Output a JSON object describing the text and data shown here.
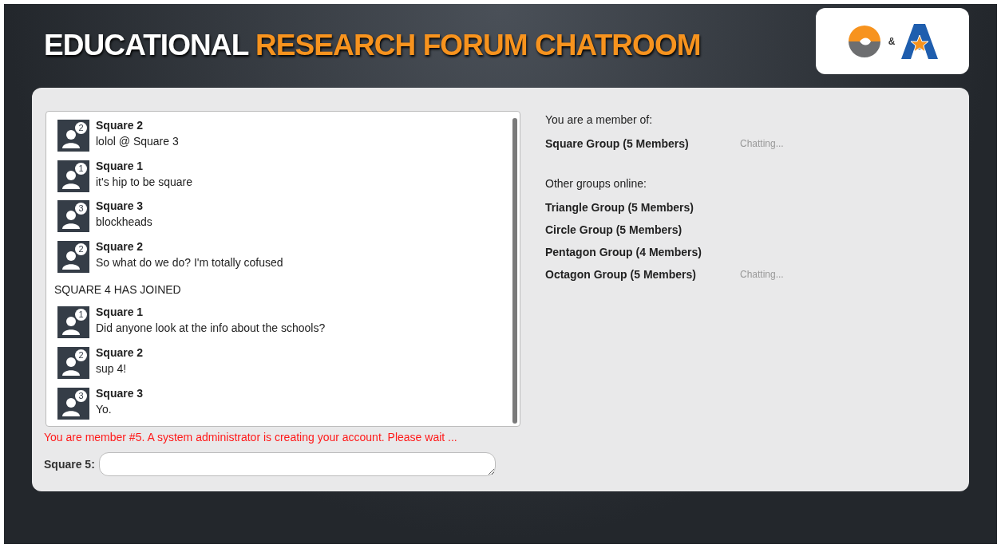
{
  "header": {
    "title_plain": "EDUCATIONAL",
    "title_accent": "RESEARCH FORUM CHATROOM",
    "logo_separator": "&"
  },
  "chat": {
    "messages": [
      {
        "kind": "message",
        "author": "Square 2",
        "badge": "2",
        "text": "lolol @ Square 3"
      },
      {
        "kind": "message",
        "author": "Square 1",
        "badge": "1",
        "text": "it's hip to be square"
      },
      {
        "kind": "message",
        "author": "Square 3",
        "badge": "3",
        "text": "blockheads"
      },
      {
        "kind": "message",
        "author": "Square 2",
        "badge": "2",
        "text": "So what do we do? I'm totally cofused"
      },
      {
        "kind": "system",
        "text": "SQUARE 4 HAS JOINED"
      },
      {
        "kind": "message",
        "author": "Square 1",
        "badge": "1",
        "text": "Did anyone look at the info about the schools?"
      },
      {
        "kind": "message",
        "author": "Square 2",
        "badge": "2",
        "text": "sup 4!"
      },
      {
        "kind": "message",
        "author": "Square 3",
        "badge": "3",
        "text": "Yo."
      }
    ],
    "notice": "You are member #5. A system administrator is creating your account. Please wait ...",
    "input_label": "Square 5:"
  },
  "groups": {
    "member_heading": "You are a member of:",
    "member_groups": [
      {
        "name": "Square Group (5 Members)",
        "status": "Chatting..."
      }
    ],
    "other_heading": "Other groups online:",
    "other_groups": [
      {
        "name": "Triangle Group (5 Members)"
      },
      {
        "name": "Circle Group (5 Members)"
      },
      {
        "name": "Pentagon Group (4 Members)"
      },
      {
        "name": "Octagon Group (5 Members)",
        "status": "Chatting..."
      }
    ]
  }
}
